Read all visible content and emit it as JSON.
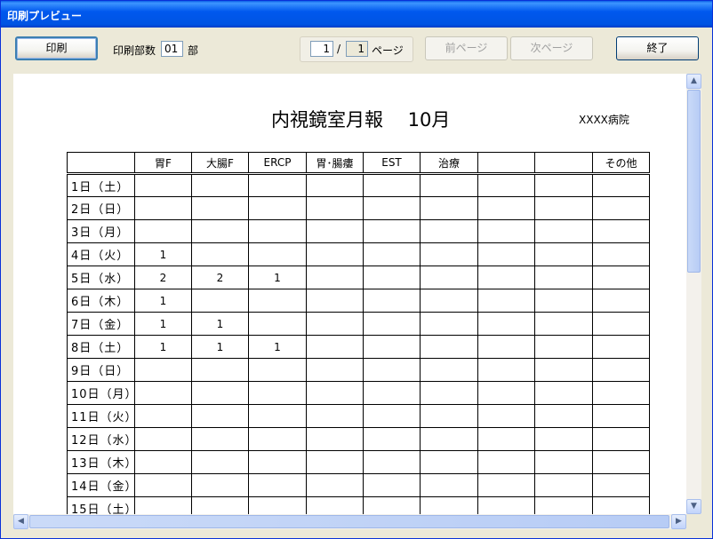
{
  "window": {
    "title": "印刷プレビュー"
  },
  "toolbar": {
    "print_label": "印刷",
    "copies_label": "印刷部数",
    "copies_value": "01",
    "copies_unit": "部",
    "page_current": "1",
    "page_separator": "/",
    "page_total": "1",
    "page_unit": "ページ",
    "prev_label": "前ページ",
    "next_label": "次ページ",
    "close_label": "終了"
  },
  "document": {
    "title": "内視鏡室月報　 10月",
    "hospital": "XXXX病院",
    "columns": [
      "",
      "胃F",
      "大腸F",
      "ERCP",
      "胃･腸瘻",
      "EST",
      "治療",
      "",
      "",
      "その他"
    ],
    "rows": [
      {
        "day": "1日（土）",
        "cells": [
          "",
          "",
          "",
          "",
          "",
          "",
          "",
          "",
          ""
        ]
      },
      {
        "day": "2日（日）",
        "cells": [
          "",
          "",
          "",
          "",
          "",
          "",
          "",
          "",
          ""
        ]
      },
      {
        "day": "3日（月）",
        "cells": [
          "",
          "",
          "",
          "",
          "",
          "",
          "",
          "",
          ""
        ]
      },
      {
        "day": "4日（火）",
        "cells": [
          "1",
          "",
          "",
          "",
          "",
          "",
          "",
          "",
          ""
        ]
      },
      {
        "day": "5日（水）",
        "cells": [
          "2",
          "2",
          "1",
          "",
          "",
          "",
          "",
          "",
          ""
        ]
      },
      {
        "day": "6日（木）",
        "cells": [
          "1",
          "",
          "",
          "",
          "",
          "",
          "",
          "",
          ""
        ]
      },
      {
        "day": "7日（金）",
        "cells": [
          "1",
          "1",
          "",
          "",
          "",
          "",
          "",
          "",
          ""
        ]
      },
      {
        "day": "8日（土）",
        "cells": [
          "1",
          "1",
          "1",
          "",
          "",
          "",
          "",
          "",
          ""
        ]
      },
      {
        "day": "9日（日）",
        "cells": [
          "",
          "",
          "",
          "",
          "",
          "",
          "",
          "",
          ""
        ]
      },
      {
        "day": "10日（月）",
        "cells": [
          "",
          "",
          "",
          "",
          "",
          "",
          "",
          "",
          ""
        ]
      },
      {
        "day": "11日（火）",
        "cells": [
          "",
          "",
          "",
          "",
          "",
          "",
          "",
          "",
          ""
        ]
      },
      {
        "day": "12日（水）",
        "cells": [
          "",
          "",
          "",
          "",
          "",
          "",
          "",
          "",
          ""
        ]
      },
      {
        "day": "13日（木）",
        "cells": [
          "",
          "",
          "",
          "",
          "",
          "",
          "",
          "",
          ""
        ]
      },
      {
        "day": "14日（金）",
        "cells": [
          "",
          "",
          "",
          "",
          "",
          "",
          "",
          "",
          ""
        ]
      },
      {
        "day": "15日（土）",
        "cells": [
          "",
          "",
          "",
          "",
          "",
          "",
          "",
          "",
          ""
        ]
      }
    ]
  },
  "scroll": {
    "icons": {
      "up": "arrow-up-icon",
      "down": "arrow-down-icon",
      "left": "arrow-left-icon",
      "right": "arrow-right-icon"
    }
  }
}
